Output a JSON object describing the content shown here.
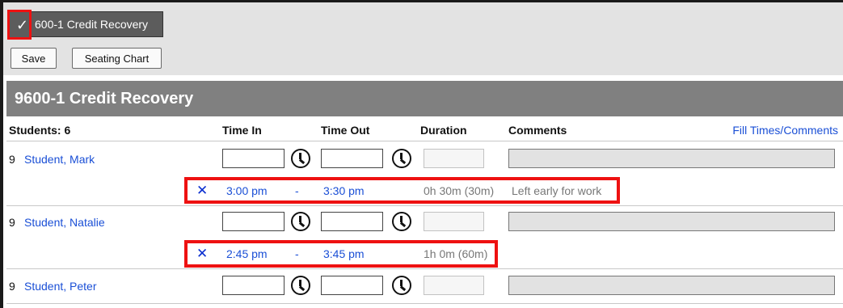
{
  "toolbar": {
    "course_button_label": "9600-1 Credit Recovery",
    "course_button_label_visible": "600-1 Credit Recovery",
    "check_icon": "check-icon",
    "save_label": "Save",
    "seating_chart_label": "Seating Chart"
  },
  "section": {
    "title": "9600-1 Credit Recovery"
  },
  "table": {
    "headers": {
      "students": "Students: 6",
      "time_in": "Time In",
      "time_out": "Time Out",
      "duration": "Duration",
      "comments": "Comments"
    },
    "fill_link": "Fill Times/Comments",
    "rows": [
      {
        "grade": "9",
        "name": "Student, Mark",
        "entry": {
          "time_in": "3:00 pm",
          "dash": "-",
          "time_out": "3:30 pm",
          "duration": "0h 30m (30m)",
          "comment": "Left early for work"
        }
      },
      {
        "grade": "9",
        "name": "Student, Natalie",
        "entry": {
          "time_in": "2:45 pm",
          "dash": "-",
          "time_out": "3:45 pm",
          "duration": "1h 0m (60m)",
          "comment": ""
        }
      },
      {
        "grade": "9",
        "name": "Student, Peter"
      }
    ]
  },
  "colors": {
    "link": "#1a4fd6",
    "highlight": "#ee1111",
    "header_bg": "#808080",
    "toolbar_bg": "#e3e3e3"
  }
}
